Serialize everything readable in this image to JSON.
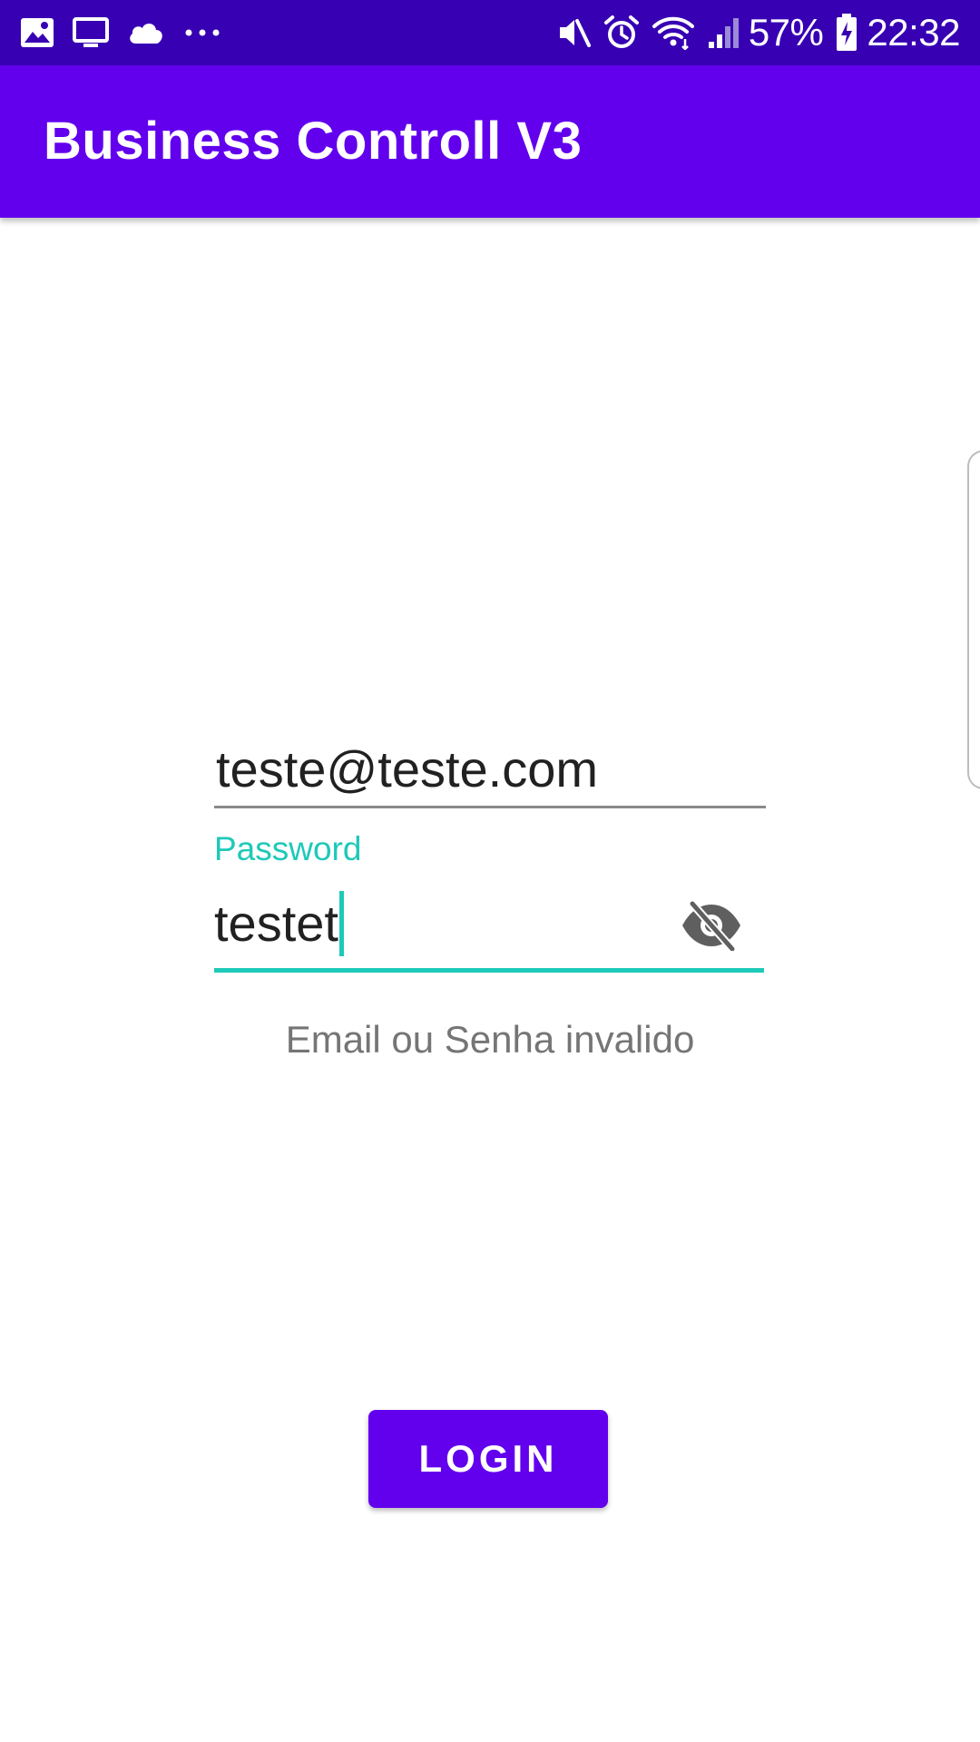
{
  "status_bar": {
    "left_icons": [
      "gallery-icon",
      "cast-screen-icon",
      "cloud-icon",
      "more-dots-icon"
    ],
    "right_icons": [
      "mute-icon",
      "alarm-icon",
      "wifi-icon",
      "signal-icon"
    ],
    "battery_percent": "57%",
    "time": "22:32"
  },
  "app_bar": {
    "title": "Business Controll V3"
  },
  "login_form": {
    "email_value": "teste@teste.com",
    "password_label": "Password",
    "password_value": "testet",
    "password_toggle_icon": "visibility-off-icon",
    "error_message": "Email ou Senha invalido",
    "login_button_label": "LOGIN"
  },
  "colors": {
    "status_bar": "#3700b3",
    "app_bar": "#6200ee",
    "accent": "#1ec9b8",
    "button": "#6200ee"
  }
}
